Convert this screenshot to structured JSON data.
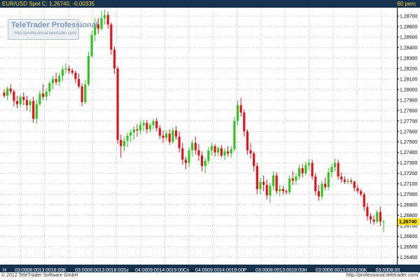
{
  "header": {
    "symbol": "EUR/USD Spot",
    "close_label": "C:",
    "close_value": "1,26740",
    "change_value": "-0,00335",
    "interval": "60 perc"
  },
  "logo": {
    "name": "TeleTrader Professional",
    "url": "http://professional.teletrader.com/"
  },
  "footer": {
    "copyright": "© 2012 TeleTrader Software GmbH",
    "url": "http://professional.teletrader.com/"
  },
  "colors": {
    "up": "#2ec61f",
    "down": "#e2131b",
    "grid": "#b9c2cc",
    "axis_bg": "#17324f",
    "last_price_bg": "#ffe200"
  },
  "chart_data": {
    "type": "candlestick",
    "y_ticks": [
      "1,28700",
      "1,28600",
      "1,28500",
      "1,28400",
      "1,28300",
      "1,28200",
      "1,28100",
      "1,28000",
      "1,27900",
      "1,27800",
      "1,27700",
      "1,27600",
      "1,27500",
      "1,27400",
      "1,27300",
      "1,27200",
      "1,27100",
      "1,27000",
      "1,26900",
      "1,26800",
      "1,26700",
      "1,26600",
      "1,26500",
      "1,26400"
    ],
    "ylim": [
      1.2633,
      1.2878
    ],
    "last_price": "1,26740",
    "x_tick_labels": [
      "H",
      "03:00",
      "08:00",
      "13:00",
      "18:00",
      "K",
      "03:00",
      "08:00",
      "13:00",
      "18:00",
      "Sz",
      "04:00",
      "09:00",
      "14:00",
      "19:00",
      "Cs",
      "04:00",
      "09:00",
      "14:00",
      "19:00",
      "P",
      "03:00",
      "08:00",
      "13:00",
      "18:00",
      "H",
      "03:00",
      "08:00",
      "13:00",
      "18:00",
      "K",
      "03:00",
      "08:00"
    ],
    "ohlc": [
      [
        1.2797,
        1.28,
        1.2792,
        1.2794
      ],
      [
        1.2794,
        1.2803,
        1.279,
        1.2801
      ],
      [
        1.2801,
        1.2805,
        1.2795,
        1.2798
      ],
      [
        1.2798,
        1.28,
        1.2784,
        1.2789
      ],
      [
        1.2789,
        1.2794,
        1.2782,
        1.2786
      ],
      [
        1.2786,
        1.2795,
        1.2783,
        1.2793
      ],
      [
        1.2793,
        1.2797,
        1.2785,
        1.279
      ],
      [
        1.279,
        1.2794,
        1.278,
        1.2785
      ],
      [
        1.2785,
        1.2791,
        1.2778,
        1.2789
      ],
      [
        1.2789,
        1.2793,
        1.2768,
        1.2772
      ],
      [
        1.2772,
        1.279,
        1.2767,
        1.2786
      ],
      [
        1.2786,
        1.2799,
        1.2784,
        1.2796
      ],
      [
        1.2796,
        1.2805,
        1.279,
        1.2793
      ],
      [
        1.2793,
        1.2801,
        1.2789,
        1.2798
      ],
      [
        1.2798,
        1.2808,
        1.2794,
        1.2806
      ],
      [
        1.2806,
        1.2813,
        1.28,
        1.281
      ],
      [
        1.281,
        1.2816,
        1.2804,
        1.2807
      ],
      [
        1.2807,
        1.2816,
        1.2803,
        1.2813
      ],
      [
        1.2813,
        1.2822,
        1.2808,
        1.2819
      ],
      [
        1.2819,
        1.2825,
        1.2815,
        1.282
      ],
      [
        1.282,
        1.2823,
        1.2815,
        1.2818
      ],
      [
        1.2818,
        1.282,
        1.2814,
        1.2816
      ],
      [
        1.2816,
        1.2818,
        1.2806,
        1.281
      ],
      [
        1.281,
        1.2815,
        1.2801,
        1.2803
      ],
      [
        1.2803,
        1.2806,
        1.2784,
        1.2788
      ],
      [
        1.2788,
        1.2809,
        1.2786,
        1.2805
      ],
      [
        1.2805,
        1.2836,
        1.2803,
        1.2832
      ],
      [
        1.2832,
        1.2856,
        1.283,
        1.2852
      ],
      [
        1.2852,
        1.2868,
        1.2846,
        1.2862
      ],
      [
        1.2862,
        1.2868,
        1.2853,
        1.2858
      ],
      [
        1.2858,
        1.2875,
        1.2856,
        1.2868
      ],
      [
        1.2868,
        1.2876,
        1.2862,
        1.2871
      ],
      [
        1.2871,
        1.2874,
        1.2858,
        1.2862
      ],
      [
        1.2862,
        1.2864,
        1.2833,
        1.2838
      ],
      [
        1.2838,
        1.2841,
        1.2815,
        1.282
      ],
      [
        1.282,
        1.2822,
        1.2748,
        1.2752
      ],
      [
        1.2752,
        1.2757,
        1.2735,
        1.2746
      ],
      [
        1.2746,
        1.2755,
        1.2741,
        1.2751
      ],
      [
        1.2751,
        1.2759,
        1.2745,
        1.2756
      ],
      [
        1.2756,
        1.2762,
        1.275,
        1.2759
      ],
      [
        1.2759,
        1.2765,
        1.2752,
        1.2762
      ],
      [
        1.2762,
        1.2767,
        1.2755,
        1.2761
      ],
      [
        1.2761,
        1.277,
        1.2757,
        1.2766
      ],
      [
        1.2766,
        1.2771,
        1.276,
        1.2768
      ],
      [
        1.2768,
        1.2771,
        1.2758,
        1.2762
      ],
      [
        1.2762,
        1.2768,
        1.2759,
        1.2766
      ],
      [
        1.2766,
        1.2772,
        1.2762,
        1.277
      ],
      [
        1.277,
        1.2773,
        1.276,
        1.2763
      ],
      [
        1.2763,
        1.2766,
        1.2753,
        1.2756
      ],
      [
        1.2756,
        1.2761,
        1.2749,
        1.2754
      ],
      [
        1.2754,
        1.2761,
        1.2751,
        1.2758
      ],
      [
        1.2758,
        1.2762,
        1.2747,
        1.275
      ],
      [
        1.275,
        1.2764,
        1.2748,
        1.2761
      ],
      [
        1.2761,
        1.2765,
        1.2752,
        1.2755
      ],
      [
        1.2755,
        1.276,
        1.274,
        1.2744
      ],
      [
        1.2744,
        1.2749,
        1.2728,
        1.2733
      ],
      [
        1.2733,
        1.2736,
        1.2724,
        1.273
      ],
      [
        1.273,
        1.2745,
        1.2726,
        1.2742
      ],
      [
        1.2742,
        1.2752,
        1.2736,
        1.2749
      ],
      [
        1.2749,
        1.2755,
        1.2738,
        1.2742
      ],
      [
        1.2742,
        1.2748,
        1.2732,
        1.2737
      ],
      [
        1.2737,
        1.2741,
        1.2722,
        1.2727
      ],
      [
        1.2727,
        1.2735,
        1.272,
        1.2732
      ],
      [
        1.2732,
        1.2745,
        1.2729,
        1.2742
      ],
      [
        1.2742,
        1.2749,
        1.2737,
        1.2746
      ],
      [
        1.2746,
        1.2748,
        1.2736,
        1.274
      ],
      [
        1.274,
        1.2746,
        1.2736,
        1.2744
      ],
      [
        1.2744,
        1.2747,
        1.2735,
        1.2737
      ],
      [
        1.2737,
        1.2744,
        1.2733,
        1.2741
      ],
      [
        1.2741,
        1.2746,
        1.2736,
        1.2739
      ],
      [
        1.2739,
        1.2746,
        1.2735,
        1.2743
      ],
      [
        1.2743,
        1.2774,
        1.2741,
        1.277
      ],
      [
        1.277,
        1.2789,
        1.2766,
        1.2785
      ],
      [
        1.2785,
        1.2792,
        1.2774,
        1.2778
      ],
      [
        1.2778,
        1.2781,
        1.2755,
        1.276
      ],
      [
        1.276,
        1.2762,
        1.2738,
        1.2742
      ],
      [
        1.2742,
        1.2749,
        1.2734,
        1.2739
      ],
      [
        1.2739,
        1.2741,
        1.2722,
        1.2727
      ],
      [
        1.2727,
        1.273,
        1.27,
        1.2705
      ],
      [
        1.2705,
        1.2716,
        1.27,
        1.2712
      ],
      [
        1.2712,
        1.2718,
        1.2703,
        1.2709
      ],
      [
        1.2709,
        1.2714,
        1.2695,
        1.2699
      ],
      [
        1.2699,
        1.2711,
        1.2692,
        1.2708
      ],
      [
        1.2708,
        1.2722,
        1.2704,
        1.2718
      ],
      [
        1.2718,
        1.2721,
        1.27,
        1.2703
      ],
      [
        1.2703,
        1.2709,
        1.2698,
        1.2705
      ],
      [
        1.2705,
        1.2708,
        1.27,
        1.2703
      ],
      [
        1.2703,
        1.2705,
        1.27,
        1.2702
      ],
      [
        1.2702,
        1.2718,
        1.27,
        1.2715
      ],
      [
        1.2715,
        1.2722,
        1.2709,
        1.2713
      ],
      [
        1.2713,
        1.272,
        1.2709,
        1.2717
      ],
      [
        1.2717,
        1.2728,
        1.2714,
        1.2725
      ],
      [
        1.2725,
        1.2729,
        1.2716,
        1.272
      ],
      [
        1.272,
        1.2731,
        1.2718,
        1.2728
      ],
      [
        1.2728,
        1.2734,
        1.2723,
        1.273
      ],
      [
        1.273,
        1.2733,
        1.2714,
        1.2717
      ],
      [
        1.2717,
        1.272,
        1.2699,
        1.2703
      ],
      [
        1.2703,
        1.2709,
        1.2694,
        1.2698
      ],
      [
        1.2698,
        1.2713,
        1.2695,
        1.271
      ],
      [
        1.271,
        1.2716,
        1.2704,
        1.2707
      ],
      [
        1.2707,
        1.2725,
        1.2704,
        1.2721
      ],
      [
        1.2721,
        1.2729,
        1.2716,
        1.2726
      ],
      [
        1.2726,
        1.2734,
        1.2722,
        1.273
      ],
      [
        1.273,
        1.2733,
        1.2714,
        1.2717
      ],
      [
        1.2717,
        1.2721,
        1.2711,
        1.2714
      ],
      [
        1.2714,
        1.2717,
        1.271,
        1.2712
      ],
      [
        1.2712,
        1.2715,
        1.271,
        1.2713
      ],
      [
        1.2713,
        1.2715,
        1.271,
        1.2712
      ],
      [
        1.2712,
        1.2713,
        1.2703,
        1.2706
      ],
      [
        1.2706,
        1.2709,
        1.2701,
        1.2703
      ],
      [
        1.2703,
        1.2705,
        1.2698,
        1.27
      ],
      [
        1.27,
        1.2702,
        1.2684,
        1.2688
      ],
      [
        1.2688,
        1.2692,
        1.2675,
        1.2679
      ],
      [
        1.2679,
        1.2682,
        1.2672,
        1.2676
      ],
      [
        1.2676,
        1.268,
        1.2671,
        1.2674
      ],
      [
        1.2674,
        1.2685,
        1.2672,
        1.2683
      ],
      [
        1.2683,
        1.2688,
        1.267,
        1.2674
      ],
      [
        1.2674,
        1.2676,
        1.2664,
        1.2674
      ]
    ]
  }
}
